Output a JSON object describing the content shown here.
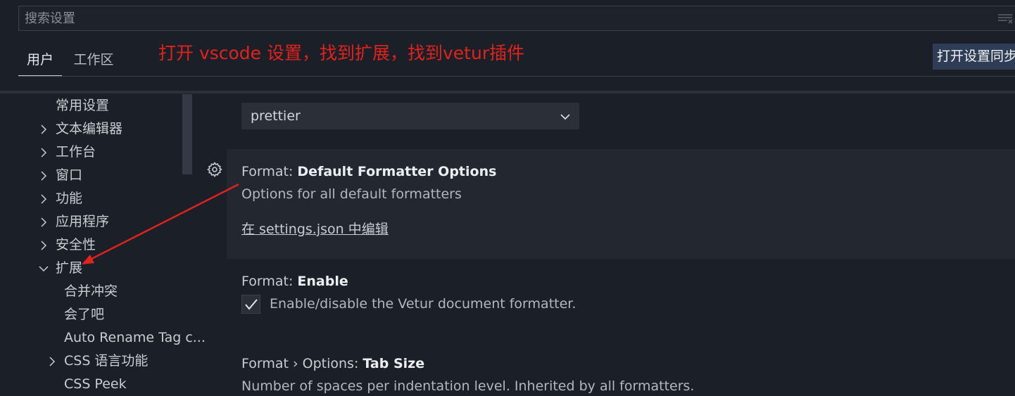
{
  "search": {
    "placeholder": "搜索设置"
  },
  "tabs": [
    {
      "label": "用户",
      "active": true
    },
    {
      "label": "工作区",
      "active": false
    }
  ],
  "annotation_text": "打开 vscode 设置，找到扩展，找到vetur插件",
  "sync_button": "打开设置同步",
  "toc": [
    {
      "label": "常用设置",
      "chevron": "none"
    },
    {
      "label": "文本编辑器",
      "chevron": "right"
    },
    {
      "label": "工作台",
      "chevron": "right"
    },
    {
      "label": "窗口",
      "chevron": "right"
    },
    {
      "label": "功能",
      "chevron": "right"
    },
    {
      "label": "应用程序",
      "chevron": "right"
    },
    {
      "label": "安全性",
      "chevron": "right"
    },
    {
      "label": "扩展",
      "chevron": "down"
    },
    {
      "label": "合并冲突",
      "chevron": "none"
    },
    {
      "label": "会了吧",
      "chevron": "none"
    },
    {
      "label": "Auto Rename Tag c...",
      "chevron": "none"
    },
    {
      "label": "CSS 语言功能",
      "chevron": "right"
    },
    {
      "label": "CSS Peek",
      "chevron": "none"
    }
  ],
  "settings": {
    "formatter_dropdown": {
      "value": "prettier"
    },
    "default_formatter_options": {
      "category": "Format: ",
      "name": "Default Formatter Options",
      "description": "Options for all default formatters",
      "link": "在 settings.json 中编辑"
    },
    "enable": {
      "category": "Format: ",
      "name": "Enable",
      "description": "Enable/disable the Vetur document formatter.",
      "checked": true
    },
    "tab_size": {
      "category": "Format › Options: ",
      "name": "Tab Size",
      "description": "Number of spaces per indentation level. Inherited by all formatters."
    }
  },
  "colors": {
    "background": "#1b1f27",
    "accent_annotation": "#e2221c",
    "sync_button_bg": "#2e3d55",
    "focused_row_bg": "#222730"
  }
}
